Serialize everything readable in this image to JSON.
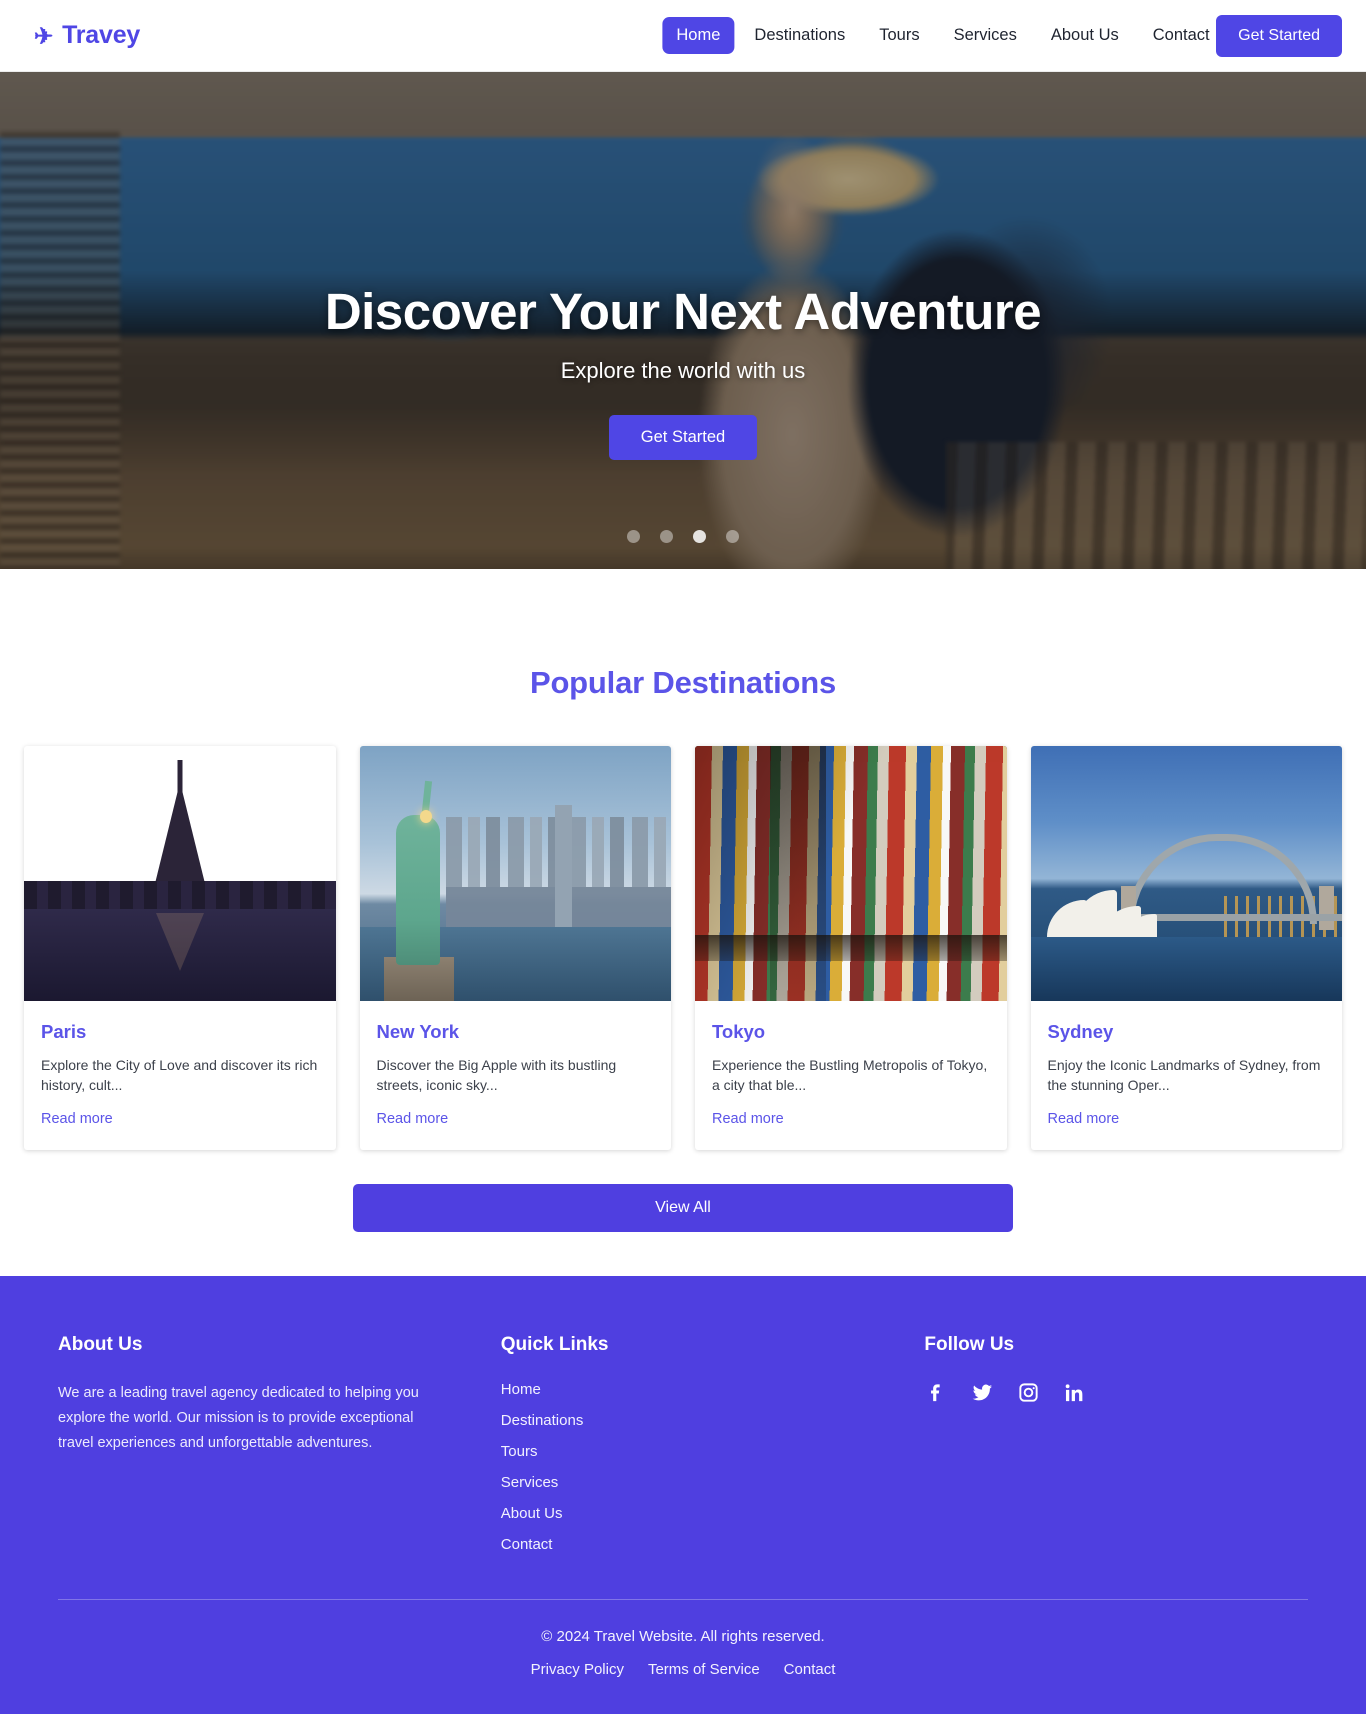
{
  "brand": {
    "name": "Travey",
    "icon": "airplane-icon",
    "color": "#4f46e5"
  },
  "header": {
    "nav": [
      {
        "label": "Home",
        "active": true
      },
      {
        "label": "Destinations",
        "active": false
      },
      {
        "label": "Tours",
        "active": false
      },
      {
        "label": "Services",
        "active": false
      },
      {
        "label": "About Us",
        "active": false
      },
      {
        "label": "Contact",
        "active": false
      }
    ],
    "cta_label": "Get Started"
  },
  "hero": {
    "title": "Discover Your Next Adventure",
    "subtitle": "Explore the world with us",
    "cta_label": "Get Started",
    "dots": 4,
    "active_dot": 3
  },
  "destinations": {
    "title": "Popular Destinations",
    "view_all_label": "View All",
    "read_more_label": "Read more",
    "cards": [
      {
        "name": "Paris",
        "description": "Explore the City of Love and discover its rich history, cult...",
        "link_label": "Read more",
        "image": "eiffel-tower-photo"
      },
      {
        "name": "New York",
        "description": "Discover the Big Apple with its bustling streets, iconic sky...",
        "link_label": "Read more",
        "image": "statue-of-liberty-photo"
      },
      {
        "name": "Tokyo",
        "description": "Experience the Bustling Metropolis of Tokyo, a city that ble...",
        "link_label": "Read more",
        "image": "tokyo-neon-street-photo"
      },
      {
        "name": "Sydney",
        "description": "Enjoy the Iconic Landmarks of Sydney, from the stunning Oper...",
        "link_label": "Read more",
        "image": "sydney-harbour-bridge-photo"
      }
    ]
  },
  "footer": {
    "about": {
      "heading": "About Us",
      "text": "We are a leading travel agency dedicated to helping you explore the world. Our mission is to provide exceptional travel experiences and unforgettable adventures."
    },
    "quick_links": {
      "heading": "Quick Links",
      "items": [
        {
          "label": "Home"
        },
        {
          "label": "Destinations"
        },
        {
          "label": "Tours"
        },
        {
          "label": "Services"
        },
        {
          "label": "About Us"
        },
        {
          "label": "Contact"
        }
      ]
    },
    "follow": {
      "heading": "Follow Us",
      "socials": [
        {
          "name": "facebook-icon"
        },
        {
          "name": "twitter-icon"
        },
        {
          "name": "instagram-icon"
        },
        {
          "name": "linkedin-icon"
        }
      ]
    },
    "copyright": "© 2024 Travel Website. All rights reserved.",
    "legal": [
      {
        "label": "Privacy Policy"
      },
      {
        "label": "Terms of Service"
      },
      {
        "label": "Contact"
      }
    ]
  },
  "colors": {
    "brand_purple": "#4f46e5",
    "footer_purple": "#4f3fe0",
    "heading_purple": "#5b54e8"
  }
}
